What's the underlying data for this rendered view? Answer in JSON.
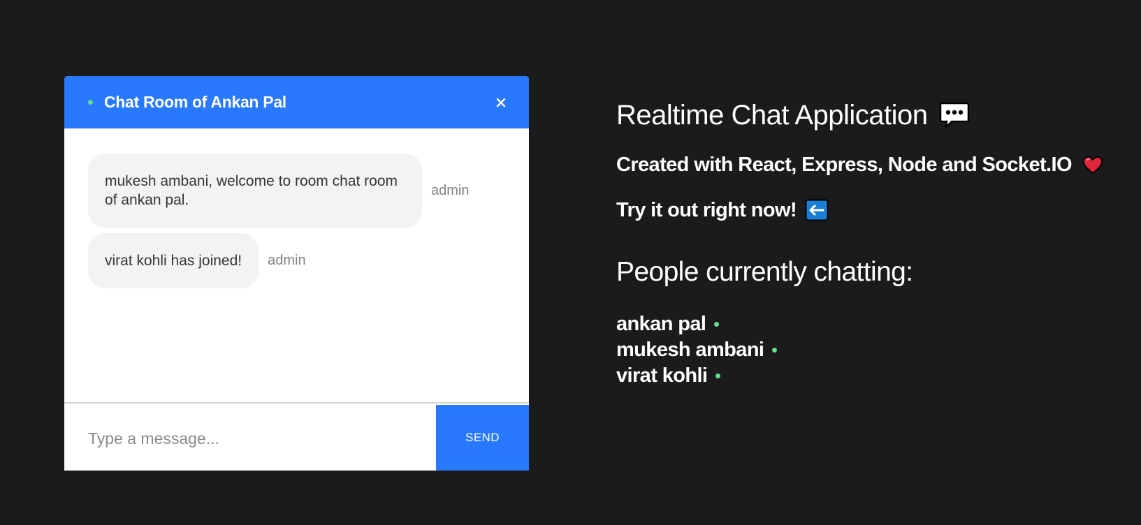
{
  "chat": {
    "title": "Chat Room of Ankan Pal",
    "messages": [
      {
        "text": "mukesh ambani, welcome to room chat room of ankan pal.",
        "sender": "admin"
      },
      {
        "text": "virat kohli has joined!",
        "sender": "admin"
      }
    ],
    "input": {
      "value": "",
      "placeholder": "Type a message..."
    },
    "send_label": "SEND"
  },
  "info": {
    "heading": "Realtime Chat Application",
    "heading_icon": "speech-bubble-icon",
    "created_with": "Created with React, Express, Node and Socket.IO",
    "created_icon": "heart-icon",
    "try_it": "Try it out right now!",
    "try_icon": "left-arrow-icon",
    "people_heading": "People currently chatting:",
    "people": [
      "ankan pal",
      "mukesh ambani",
      "virat kohli"
    ]
  },
  "colors": {
    "background": "#1b1b1d",
    "accent": "#2979ff",
    "online": "#62e08e",
    "bubble": "#f3f3f3"
  }
}
